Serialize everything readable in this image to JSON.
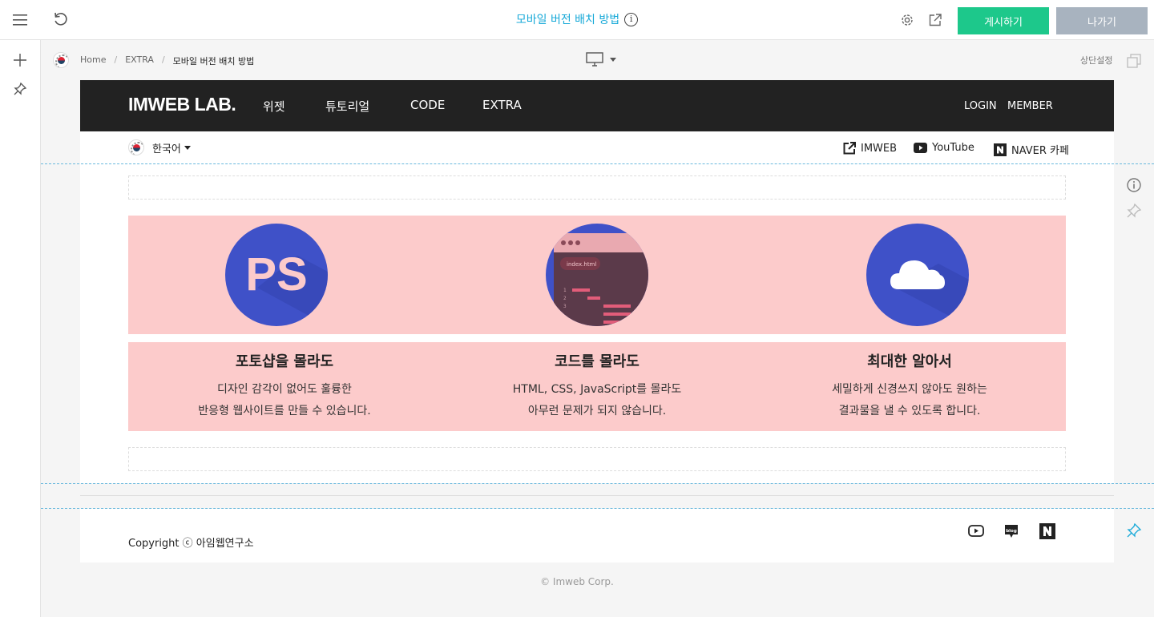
{
  "editor": {
    "title": "모바일 버전 배치 방법",
    "publish_label": "게시하기",
    "exit_label": "나가기",
    "breadcrumb": [
      "Home",
      "EXTRA",
      "모바일 버전 배치 방법"
    ],
    "top_setting_label": "상단설정",
    "accent_color": "#1dc88b",
    "title_color": "#17a9d8"
  },
  "site": {
    "logo": "IMWEB LAB.",
    "nav": [
      "위젯",
      "튜토리얼",
      "CODE",
      "EXTRA"
    ],
    "header_links": [
      "LOGIN",
      "MEMBER"
    ],
    "language": "한국어",
    "external_links": [
      {
        "label": "IMWEB",
        "icon": "external-link-icon"
      },
      {
        "label": "YouTube",
        "icon": "youtube-icon"
      },
      {
        "label": "NAVER 카페",
        "icon": "naver-icon"
      }
    ],
    "features": [
      {
        "title": "포토샵을 몰라도",
        "line1": "디자인 감각이 없어도 훌륭한",
        "line2": "반응형 웹사이트를 만들 수 있습니다.",
        "icon": "photoshop-icon"
      },
      {
        "title": "코드를 몰라도",
        "line1": "HTML, CSS, JavaScript를 몰라도",
        "line2": "아무런 문제가 되지 않습니다.",
        "icon": "code-editor-icon"
      },
      {
        "title": "최대한 알아서",
        "line1": "세밀하게 신경쓰지 않아도 원하는",
        "line2": "결과물을 낼 수 있도록 합니다.",
        "icon": "cloud-icon"
      }
    ],
    "ps_text": "PS",
    "code_file": "index.html",
    "code_lines": [
      "1",
      "2",
      "3"
    ],
    "copyright": "Copyright ⓒ 아임웹연구소",
    "corp": "© Imweb Corp."
  }
}
